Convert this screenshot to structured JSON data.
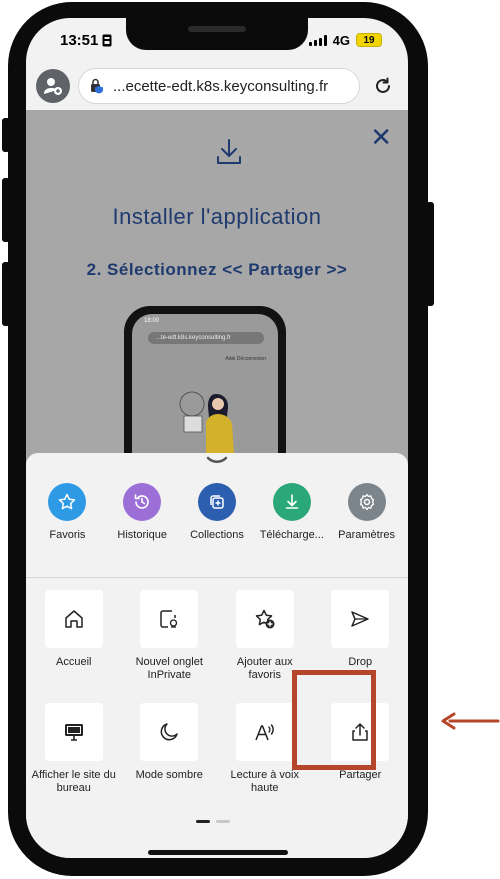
{
  "status": {
    "time": "13:51",
    "network": "4G",
    "battery": "19"
  },
  "browser": {
    "url": "...ecette-edt.k8s.keyconsulting.fr"
  },
  "page": {
    "close": "✕",
    "title": "Installer l'application",
    "step": "2. Sélectionnez << Partager >>",
    "mini_time": "18:00",
    "mini_url": "...te-edt.k8s.keyconsulting.fr",
    "mini_links": "Aide  Déconnexion"
  },
  "sheet": {
    "top_items": [
      {
        "label": "Favoris",
        "icon": "star-icon",
        "color": "#2e9ae6"
      },
      {
        "label": "Historique",
        "icon": "history-icon",
        "color": "#9b6fd6"
      },
      {
        "label": "Collections",
        "icon": "collections-icon",
        "color": "#2d5fb0"
      },
      {
        "label": "Télécharge...",
        "icon": "download-icon",
        "color": "#2aa87a"
      },
      {
        "label": "Paramètres",
        "icon": "gear-icon",
        "color": "#7d858c"
      }
    ],
    "grid_items": [
      {
        "label": "Accueil",
        "icon": "home-icon"
      },
      {
        "label": "Nouvel onglet InPrivate",
        "icon": "inprivate-tab-icon"
      },
      {
        "label": "Ajouter aux favoris",
        "icon": "add-favorite-icon"
      },
      {
        "label": "Drop",
        "icon": "send-icon"
      },
      {
        "label": "Afficher le site du bureau",
        "icon": "desktop-icon"
      },
      {
        "label": "Mode sombre",
        "icon": "moon-icon"
      },
      {
        "label": "Lecture à voix haute",
        "icon": "read-aloud-icon"
      },
      {
        "label": "Partager",
        "icon": "share-icon"
      }
    ]
  },
  "colors": {
    "highlight": "#b5452b",
    "title": "#1f3a6e"
  }
}
